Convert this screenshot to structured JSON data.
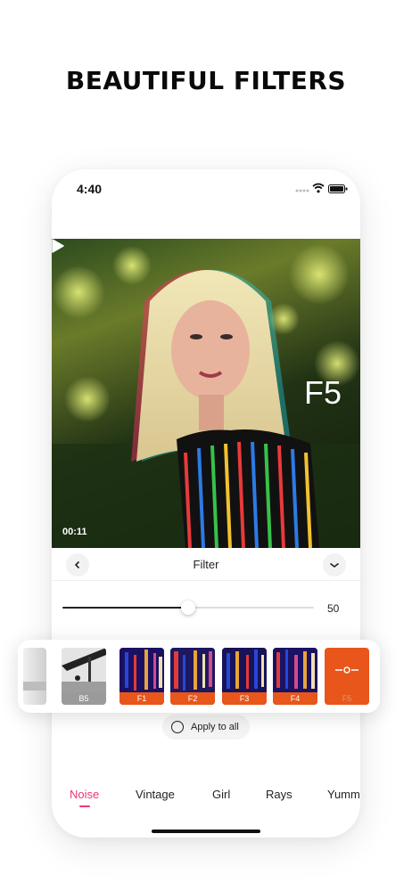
{
  "headline": "BEAUTIFUL FILTERS",
  "status_bar": {
    "time": "4:40"
  },
  "preview": {
    "filter_name": "F5",
    "video_time": "00:11"
  },
  "toolbar": {
    "title": "Filter"
  },
  "intensity_slider": {
    "value": 50,
    "max": 100,
    "value_label": "50"
  },
  "filters": [
    {
      "label": "",
      "style": "first"
    },
    {
      "label": "B5",
      "style": "bw"
    },
    {
      "label": "F1",
      "style": "glitch"
    },
    {
      "label": "F2",
      "style": "glitch"
    },
    {
      "label": "F3",
      "style": "glitch"
    },
    {
      "label": "F4",
      "style": "glitch"
    },
    {
      "label": "F5",
      "style": "orange",
      "selected": true
    }
  ],
  "apply_all": {
    "label": "Apply to all",
    "checked": false
  },
  "categories": [
    {
      "label": "Noise",
      "active": true
    },
    {
      "label": "Vintage",
      "active": false
    },
    {
      "label": "Girl",
      "active": false
    },
    {
      "label": "Rays",
      "active": false
    },
    {
      "label": "Yummy",
      "active": false
    }
  ],
  "colors": {
    "accent": "#f0357a",
    "filter_label_bg": "#e8561b"
  },
  "icons": {
    "back": "chevron-left-icon",
    "confirm": "chevron-down-icon",
    "play": "play-icon",
    "wifi": "wifi-icon",
    "battery": "battery-icon"
  }
}
